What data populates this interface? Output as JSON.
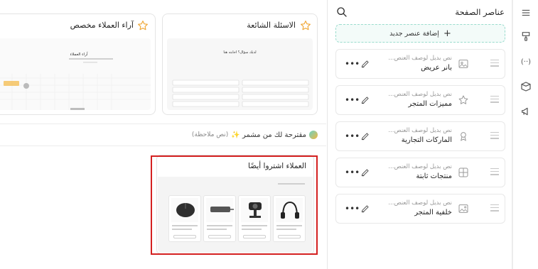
{
  "panel": {
    "title": "عناصر الصفحة",
    "add_element_label": "إضافة عنصر جديد"
  },
  "elements": [
    {
      "sub": "نص بديل لوصف العنص...",
      "name": "بانر عريض",
      "icon": "image-icon"
    },
    {
      "sub": "نص بديل لوصف العنص...",
      "name": "مميزات المتجر",
      "icon": "star-icon"
    },
    {
      "sub": "نص بديل لوصف العنص...",
      "name": "الماركات التجارية",
      "icon": "award-icon"
    },
    {
      "sub": "نص بديل لوصف العنص...",
      "name": "منتجات ثابتة",
      "icon": "grid-icon"
    },
    {
      "sub": "نص بديل لوصف العنص...",
      "name": "خلفية المتجر",
      "icon": "image-frame-icon"
    }
  ],
  "preview": {
    "faq_title": "الاسئلة الشائعة",
    "testimonials_title": "آراء العملاء مخصص",
    "faq_thumb_heading": "لديك سؤال؟ اجابته هنا",
    "testimonials_thumb_heading": "آراء العملاء",
    "suggest_main": "مقترحة لك من مشمر ✨",
    "suggest_note": "(نص ملاحظة)",
    "customers_title": "العملاء اشتروا أيضًا"
  },
  "rail": {
    "icons": [
      "menu-icon",
      "paint-icon",
      "code-icon",
      "box-icon",
      "megaphone-icon"
    ]
  },
  "colors": {
    "accent": "#5cc8b3",
    "highlight": "#d42020"
  }
}
